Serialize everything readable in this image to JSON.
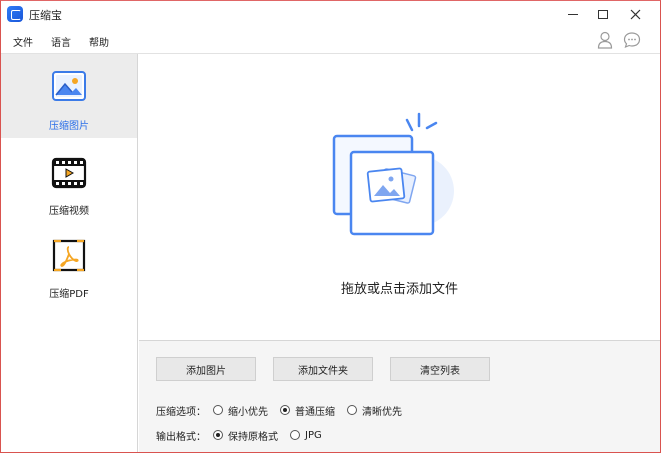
{
  "window": {
    "title": "压缩宝"
  },
  "menu": {
    "items": [
      "文件",
      "语言",
      "帮助"
    ]
  },
  "sidebar": {
    "items": [
      {
        "label": "压缩图片",
        "icon": "image-icon",
        "active": true
      },
      {
        "label": "压缩视频",
        "icon": "video-icon",
        "active": false
      },
      {
        "label": "压缩PDF",
        "icon": "pdf-icon",
        "active": false
      }
    ]
  },
  "dropzone": {
    "text": "拖放或点击添加文件"
  },
  "toolbar": {
    "add_images": "添加图片",
    "add_folder": "添加文件夹",
    "clear_list": "清空列表"
  },
  "compression": {
    "label": "压缩选项：",
    "options": [
      "缩小优先",
      "普通压缩",
      "清晰优先"
    ],
    "selected": "普通压缩"
  },
  "output": {
    "label": "输出格式：",
    "options": [
      "保持原格式",
      "JPG"
    ],
    "selected": "保持原格式"
  },
  "colors": {
    "accent": "#2a6ee8",
    "illustration": "#4a86f0",
    "window_border": "#d9534f"
  }
}
